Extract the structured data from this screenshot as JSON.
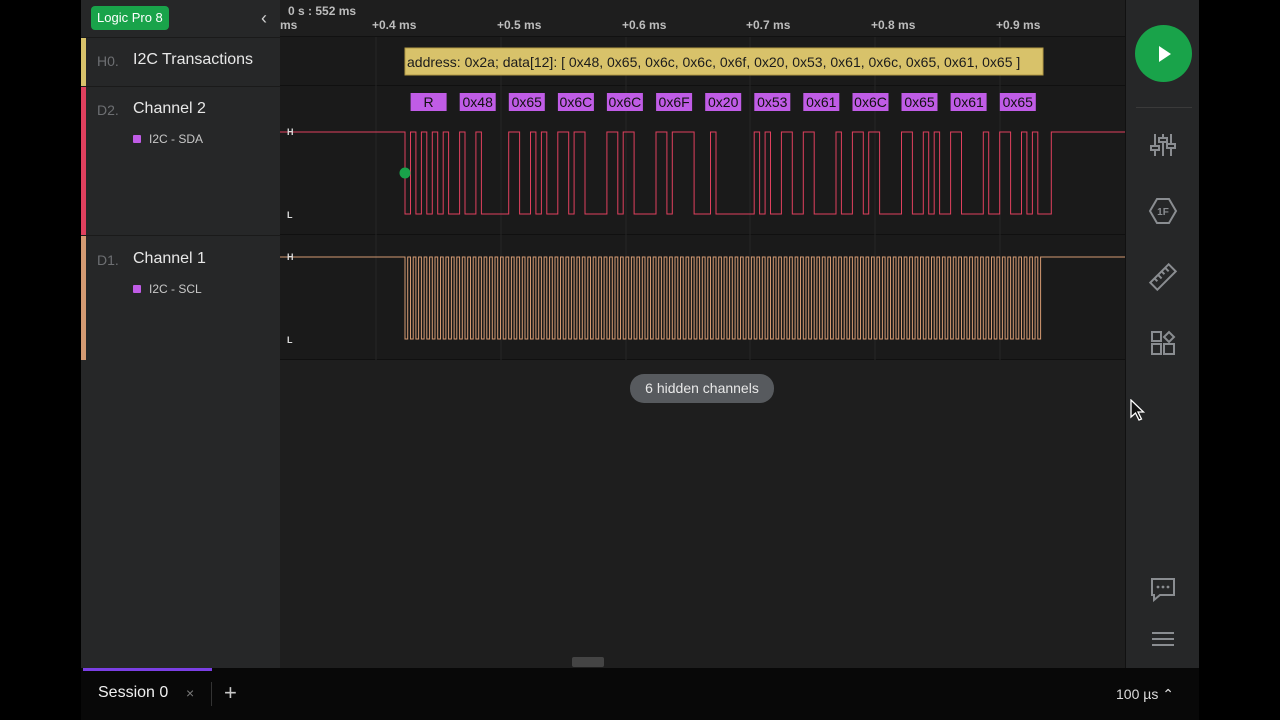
{
  "device": {
    "badge": "Logic Pro 8"
  },
  "ruler": {
    "ticks": [
      "ms",
      "0 s : 552 ms",
      "+0.4 ms",
      "+0.5 ms",
      "+0.6 ms",
      "+0.7 ms",
      "+0.8 ms",
      "+0.9 ms"
    ]
  },
  "channels": [
    {
      "code": "H0.",
      "name": "I2C Transactions",
      "color": "#d8c26a"
    },
    {
      "code": "D2.",
      "name": "Channel 2",
      "analyzer": "I2C - SDA",
      "color": "#e0405e"
    },
    {
      "code": "D1.",
      "name": "Channel 1",
      "analyzer": "I2C - SCL",
      "color": "#d49a72"
    }
  ],
  "transaction": {
    "label": "address: 0x2a; data[12]: [ 0x48, 0x65, 0x6c, 0x6c, 0x6f, 0x20, 0x53, 0x61, 0x6c, 0x65, 0x61, 0x65 ]"
  },
  "bytes": [
    "R",
    "0x48",
    "0x65",
    "0x6C",
    "0x6C",
    "0x6F",
    "0x20",
    "0x53",
    "0x61",
    "0x6C",
    "0x65",
    "0x61",
    "0x65"
  ],
  "level_labels": {
    "high": "H",
    "low": "L"
  },
  "hidden_channels": "6 hidden channels",
  "toolbar": {
    "icons": [
      "play-icon",
      "analyzers-icon",
      "extensions-icon",
      "measurements-icon",
      "layout-icon",
      "comments-icon",
      "menu-icon"
    ],
    "extension_badge": "1F"
  },
  "bottom": {
    "session_tab": "Session 0",
    "close": "×",
    "add": "+",
    "time_scale": "100 µs ⌃"
  },
  "colors": {
    "accent": "#19a34a",
    "decoder": "#c05ce6",
    "transaction": "#d8c26a",
    "sda": "#e0405e",
    "scl": "#d49a72",
    "tab_indicator": "#7b3fe4"
  }
}
